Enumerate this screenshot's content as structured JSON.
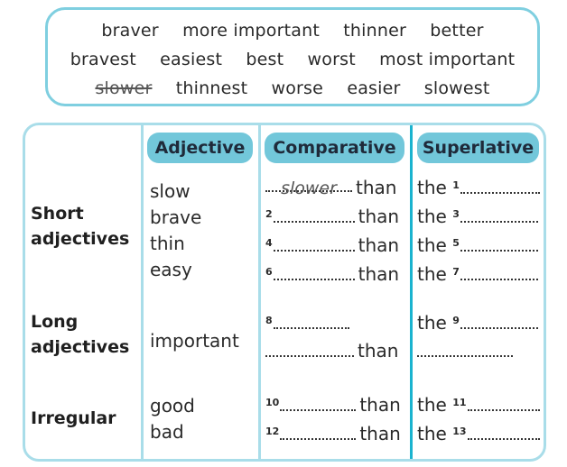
{
  "word_box": {
    "lines": [
      [
        {
          "text": "braver"
        },
        {
          "text": "more important"
        },
        {
          "text": "thinner"
        },
        {
          "text": "better"
        }
      ],
      [
        {
          "text": "bravest"
        },
        {
          "text": "easiest"
        },
        {
          "text": "best"
        },
        {
          "text": "worst"
        },
        {
          "text": "most important"
        }
      ],
      [
        {
          "text": "slower",
          "struck": true
        },
        {
          "text": "thinnest"
        },
        {
          "text": "worse"
        },
        {
          "text": "easier"
        },
        {
          "text": "slowest"
        }
      ]
    ]
  },
  "table": {
    "headers": {
      "adjective": "Adjective",
      "comparative": "Comparative",
      "superlative": "Superlative"
    },
    "connector_than": "than",
    "connector_the": "the",
    "groups": [
      {
        "label_lines": [
          "Short",
          "adjectives"
        ],
        "rows": [
          {
            "adjective": "slow",
            "comp_num": "",
            "comp_answer": "slower",
            "sup_num": "1"
          },
          {
            "adjective": "brave",
            "comp_num": "2",
            "comp_answer": "",
            "sup_num": "3"
          },
          {
            "adjective": "thin",
            "comp_num": "4",
            "comp_answer": "",
            "sup_num": "5"
          },
          {
            "adjective": "easy",
            "comp_num": "6",
            "comp_answer": "",
            "sup_num": "7"
          }
        ]
      },
      {
        "label_lines": [
          "Long",
          "adjectives"
        ],
        "rows": [
          {
            "adjective": "important",
            "comp_num": "8",
            "comp_answer": "",
            "sup_num": "9"
          }
        ]
      },
      {
        "label_lines": [
          "Irregular"
        ],
        "rows": [
          {
            "adjective": "good",
            "comp_num": "10",
            "comp_answer": "",
            "sup_num": "11"
          },
          {
            "adjective": "bad",
            "comp_num": "12",
            "comp_answer": "",
            "sup_num": "13"
          }
        ]
      }
    ]
  },
  "colors": {
    "box_border": "#7fcfe0",
    "table_border": "#a9dde9",
    "header_pill": "#72c7da",
    "accent_divider": "#1ab3cf"
  }
}
